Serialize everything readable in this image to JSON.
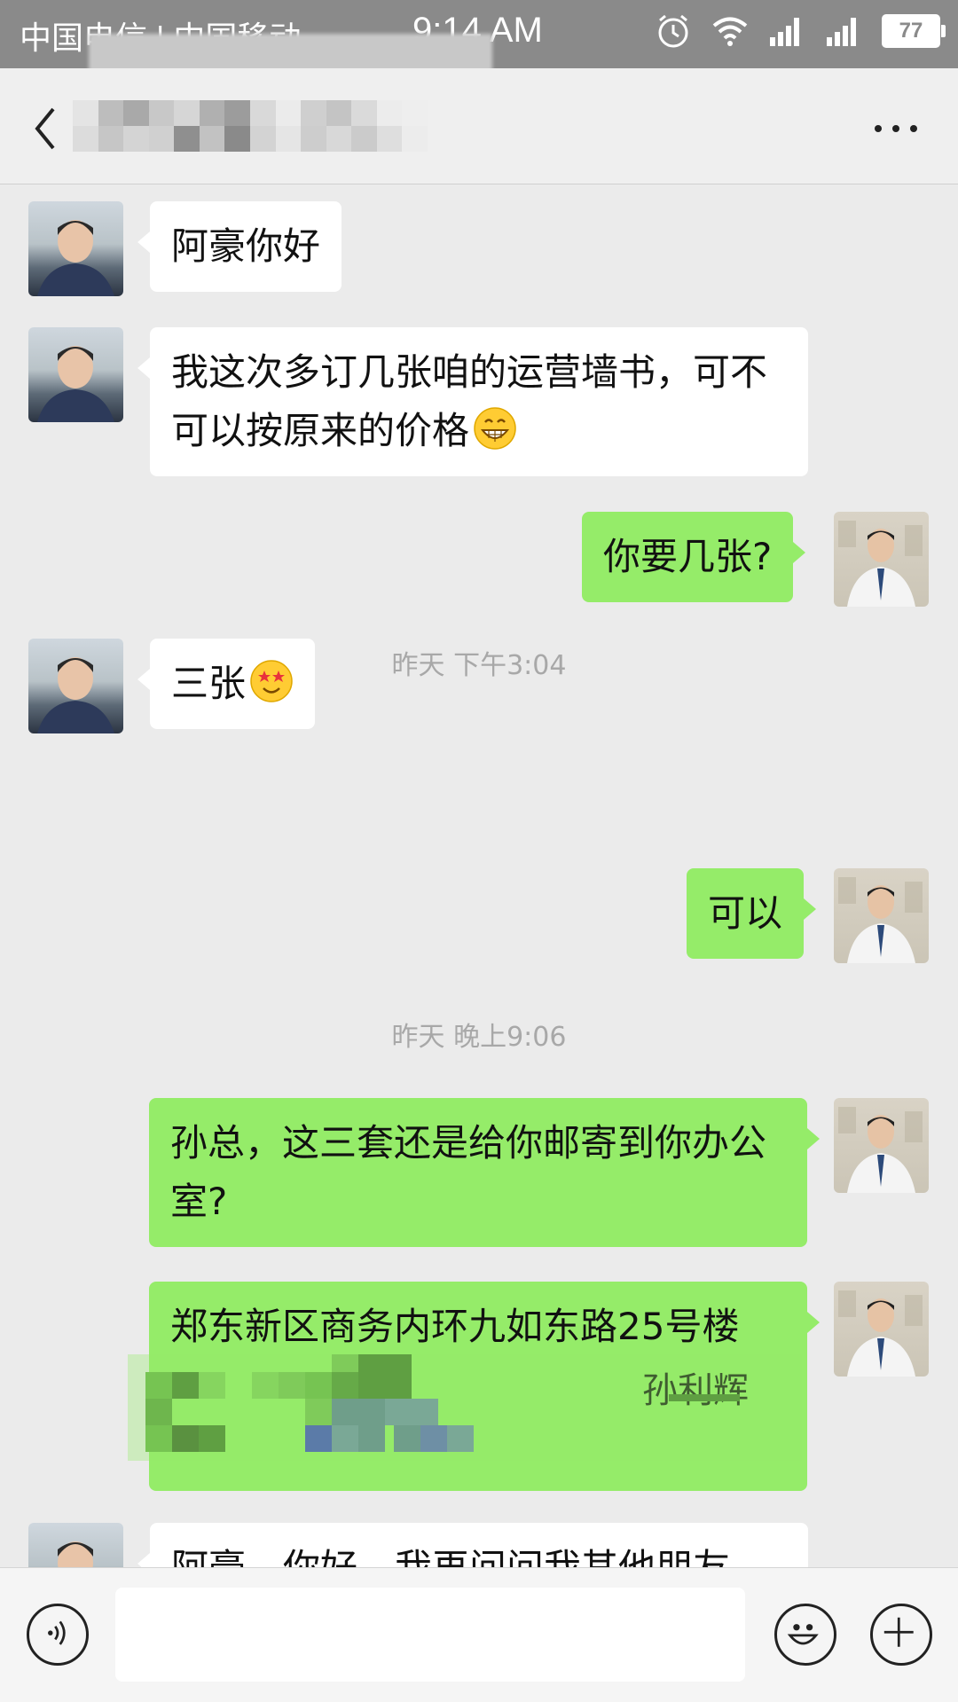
{
  "status_bar": {
    "carriers": "中国电信 | 中国移动",
    "time": "9:14 AM",
    "battery": "77"
  },
  "nav": {
    "back_icon": "chevron-left-icon",
    "more_icon": "more-dots-icon"
  },
  "messages": [
    {
      "side": "in",
      "text": "阿豪你好"
    },
    {
      "side": "in",
      "text": "我这次多订几张咱的运营墙书，可不可以按原来的价格",
      "emoji": "grin-emoji"
    },
    {
      "side": "out",
      "text": "你要几张?"
    },
    {
      "side": "in",
      "text": "三张",
      "emoji": "starstruck-emoji"
    },
    {
      "side": "out",
      "text": "可以"
    },
    {
      "side": "out",
      "text": "孙总，这三套还是给你邮寄到你办公室?"
    },
    {
      "side": "out",
      "text": "郑东新区商务内环九如东路25号楼",
      "extra": "孙利辉"
    },
    {
      "side": "in",
      "text": "阿豪，你好，我再问问我其他朋友"
    }
  ],
  "timestamps": [
    "昨天 下午3:04",
    "昨天 晚上9:06"
  ],
  "input_bar": {
    "voice_icon": "voice-icon",
    "emoji_icon": "smiley-icon",
    "plus_icon": "plus-icon",
    "placeholder": ""
  },
  "colors": {
    "outgoing_bubble": "#95ec69",
    "incoming_bubble": "#ffffff",
    "background": "#ebebeb"
  }
}
